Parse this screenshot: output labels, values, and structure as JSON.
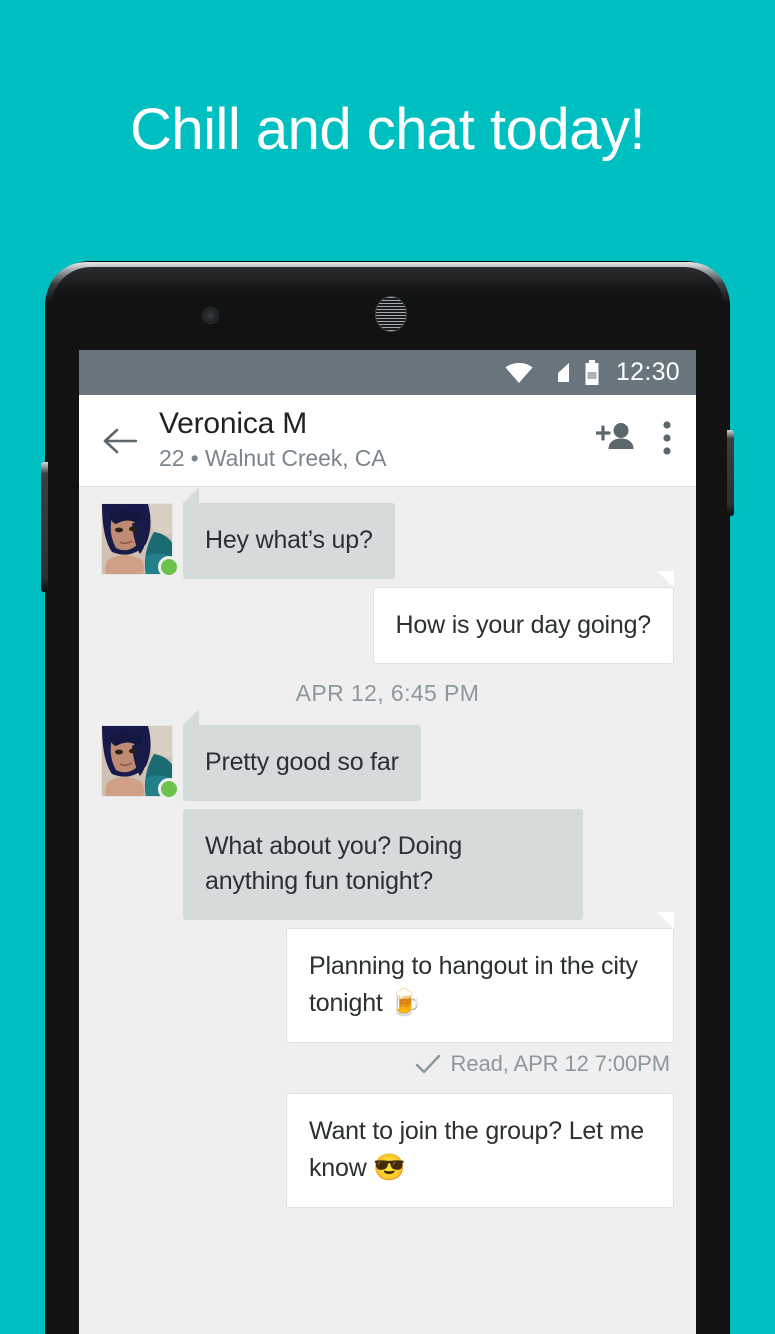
{
  "promo": {
    "headline": "Chill and chat today!",
    "background_color": "#00bfc1",
    "text_color": "#ffffff"
  },
  "phone": {
    "camera_icon": "front-camera",
    "speaker_icon": "earpiece-speaker",
    "power_button": "power-button",
    "volume_button": "volume-rocker"
  },
  "status_bar": {
    "background_color": "#68757d",
    "wifi_icon": "wifi-icon",
    "signal_icon": "cell-signal-icon",
    "battery_icon": "battery-icon",
    "time": "12:30"
  },
  "app_bar": {
    "back_icon": "back-arrow-icon",
    "name": "Veronica M",
    "subtitle": "22 • Walnut Creek, CA",
    "add_person_icon": "add-person-icon",
    "overflow_icon": "more-vertical-icon"
  },
  "conversation": {
    "online_status_color": "#6cc24a",
    "incoming_bubble_color": "#d5dadb",
    "outgoing_bubble_color": "#ffffff",
    "items": [
      {
        "kind": "message",
        "direction": "in",
        "text": "Hey what’s up?",
        "avatar": true,
        "tail": true
      },
      {
        "kind": "message",
        "direction": "out",
        "text": "How is your day going?",
        "avatar": false,
        "tail": true
      },
      {
        "kind": "divider",
        "text": "APR 12, 6:45 PM"
      },
      {
        "kind": "message",
        "direction": "in",
        "text": "Pretty good so far",
        "avatar": true,
        "tail": true
      },
      {
        "kind": "message",
        "direction": "in",
        "text": "What about you? Doing anything fun tonight?",
        "avatar": false,
        "tail": false
      },
      {
        "kind": "message",
        "direction": "out",
        "text": "Planning to hangout in the city tonight ",
        "emoji": "🍺",
        "avatar": false,
        "tail": true
      },
      {
        "kind": "receipt",
        "icon": "check-icon",
        "text": "Read, APR 12 7:00PM"
      },
      {
        "kind": "message",
        "direction": "out",
        "text": "Want to join the group? Let me know ",
        "emoji": "😎",
        "avatar": false,
        "tail": false
      }
    ]
  }
}
